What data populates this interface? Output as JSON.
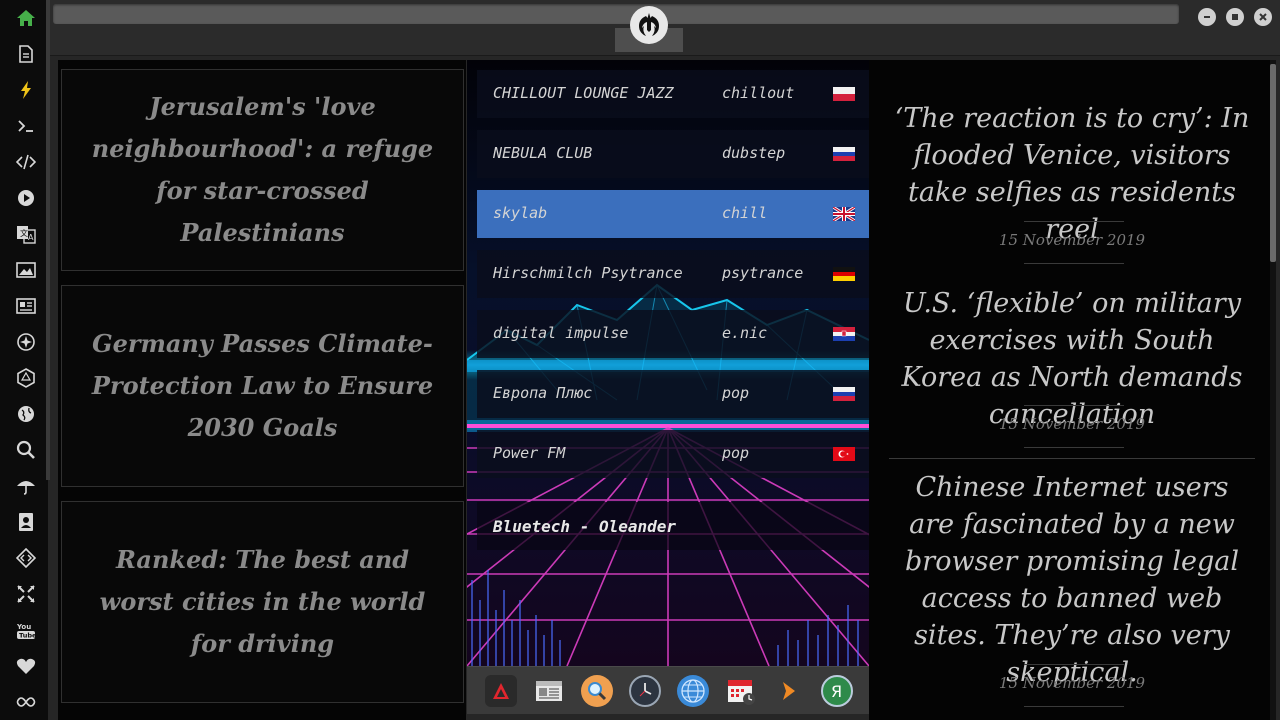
{
  "colors": {
    "accent_green": "#46b04a",
    "selected": "#3b6fbd",
    "neon_cyan": "#20d8ff",
    "neon_pink": "#ff4fd8"
  },
  "sidebar": {
    "items": [
      {
        "name": "home-icon"
      },
      {
        "name": "document-icon"
      },
      {
        "name": "bolt-icon"
      },
      {
        "name": "terminal-icon"
      },
      {
        "name": "code-icon"
      },
      {
        "name": "play-icon"
      },
      {
        "name": "translate-icon"
      },
      {
        "name": "image-icon"
      },
      {
        "name": "newspaper-icon"
      },
      {
        "name": "atom-icon"
      },
      {
        "name": "hexagon-icon"
      },
      {
        "name": "globe-icon"
      },
      {
        "name": "search-icon"
      },
      {
        "name": "umbrella-icon"
      },
      {
        "name": "contacts-icon"
      },
      {
        "name": "diamond-code-icon"
      },
      {
        "name": "expand-icon"
      },
      {
        "name": "youtube-icon"
      },
      {
        "name": "heart-icon"
      },
      {
        "name": "infinity-icon"
      }
    ]
  },
  "left_news": [
    {
      "title": "Jerusalem's 'love neighbourhood': a refuge for star-crossed Palestinians"
    },
    {
      "title": "Germany Passes Climate-Protection Law to Ensure 2030 Goals"
    },
    {
      "title": "Ranked: The best and worst cities in the world for driving"
    }
  ],
  "stations": [
    {
      "name": "CHILLOUT LOUNGE JAZZ",
      "genre": "chillout",
      "flag": "poland"
    },
    {
      "name": "NEBULA CLUB",
      "genre": "dubstep",
      "flag": "russia"
    },
    {
      "name": "skylab",
      "genre": "chill",
      "flag": "uk"
    },
    {
      "name": "Hirschmilch Psytrance",
      "genre": "psytrance",
      "flag": "germany"
    },
    {
      "name": "digital impulse",
      "genre": "e.nic",
      "flag": "croatia"
    },
    {
      "name": "Европа Плюс",
      "genre": "pop",
      "flag": "russia"
    },
    {
      "name": "Power FM",
      "genre": "pop",
      "flag": "turkey"
    }
  ],
  "now_playing": "Bluetech - Oleander",
  "dock": [
    {
      "name": "app-launcher-icon"
    },
    {
      "name": "news-reader-icon"
    },
    {
      "name": "search-app-icon"
    },
    {
      "name": "clock-icon"
    },
    {
      "name": "browser-globe-icon"
    },
    {
      "name": "calendar-icon"
    },
    {
      "name": "forward-arrow-icon"
    },
    {
      "name": "yandex-icon"
    }
  ],
  "right_news": [
    {
      "title": "‘The reaction is to cry’: In flooded Venice, visitors take selfies as residents reel",
      "date": "15 November 2019"
    },
    {
      "title": "U.S. ‘flexible’ on military exercises with South Korea as North demands cancellation",
      "date": "15 November 2019"
    },
    {
      "title": "Chinese Internet users are fascinated by a new browser promising legal access to banned web sites. They’re also very skeptical.",
      "date": "15 November 2019"
    }
  ]
}
